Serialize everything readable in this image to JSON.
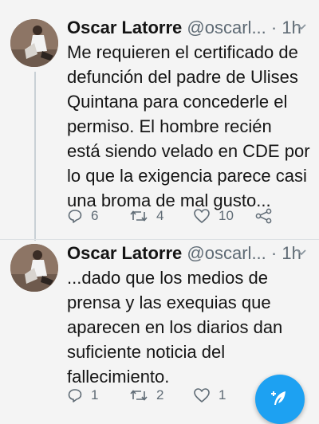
{
  "tweets": [
    {
      "author_name": "Oscar Latorre",
      "handle": "@oscarl...",
      "separator": "·",
      "time": "1h",
      "lines": [
        "Me requieren el certificado de",
        "defunción del padre de Ulises",
        "Quintana para concederle el",
        "permiso. El hombre recién",
        "está siendo velado en CDE por",
        "lo que la exigencia parece casi",
        "una broma de mal gusto..."
      ],
      "replies": "6",
      "retweets": "4",
      "likes": "10"
    },
    {
      "author_name": "Oscar Latorre",
      "handle": "@oscarl...",
      "separator": "·",
      "time": "1h",
      "lines": [
        "...dado que los medios de",
        "prensa y las exequias que",
        "aparecen en los diarios dan",
        "suficiente noticia del",
        "fallecimiento."
      ],
      "replies": "1",
      "retweets": "2",
      "likes": "1"
    }
  ],
  "icons": {
    "reply": "reply-icon",
    "retweet": "retweet-icon",
    "like": "heart-icon",
    "share": "share-icon",
    "compose": "compose-feather-icon",
    "more": "chevron-down-icon"
  },
  "colors": {
    "background": "#f4f4f4",
    "accent": "#1da1f2",
    "muted": "#5f6b75",
    "text": "#151515"
  }
}
